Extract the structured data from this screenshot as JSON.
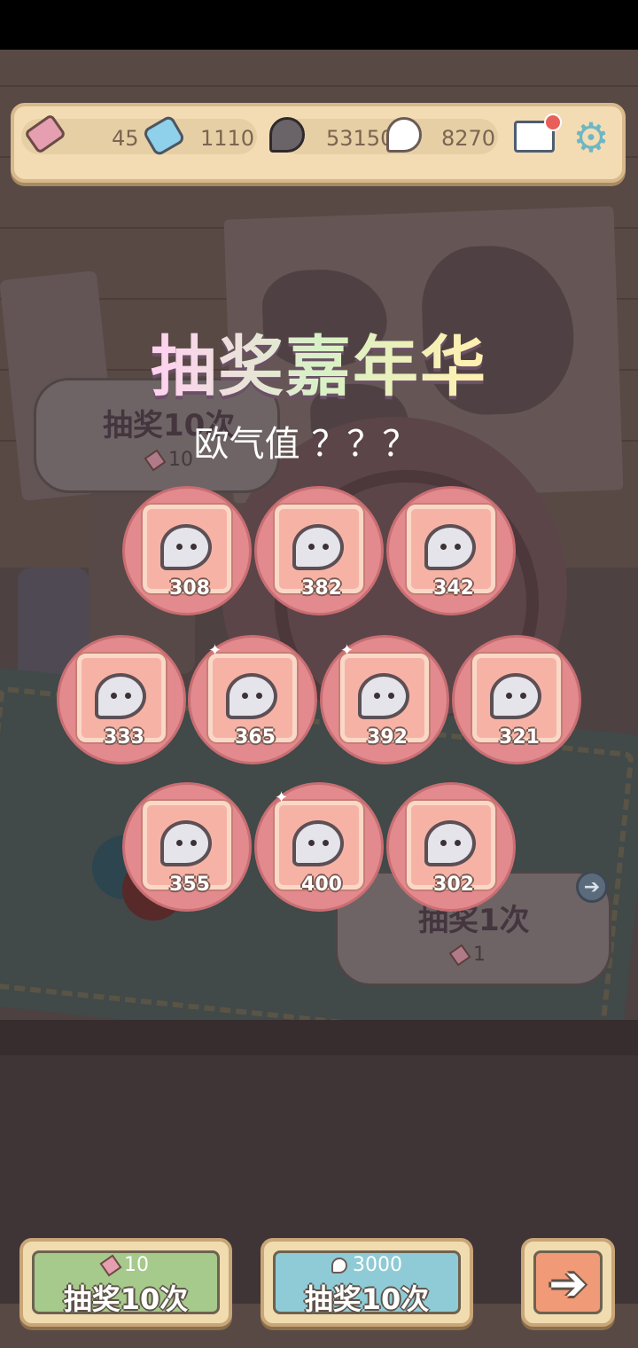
{
  "resources": {
    "tickets": "45",
    "gems": "1110",
    "dark_ghosts": "53150",
    "white_ghosts": "8270"
  },
  "header": {
    "title": "抽奖嘉年华",
    "luck_label": "欧气值 ？？？"
  },
  "background_buttons": {
    "draw10_label": "抽奖10次",
    "draw10_cost": "10",
    "draw1_label": "抽奖1次",
    "draw1_cost": "1"
  },
  "prizes": [
    {
      "value": "308"
    },
    {
      "value": "382"
    },
    {
      "value": "342"
    },
    {
      "value": "333"
    },
    {
      "value": "365"
    },
    {
      "value": "392"
    },
    {
      "value": "321"
    },
    {
      "value": "355"
    },
    {
      "value": "400"
    },
    {
      "value": "302"
    }
  ],
  "bottom": {
    "ticket_draw": {
      "cost": "10",
      "label": "抽奖10次"
    },
    "ghost_draw": {
      "cost": "3000",
      "label": "抽奖10次"
    },
    "next_icon": "right-arrow-icon"
  },
  "icons": [
    "ticket-icon",
    "gem-icon",
    "dark-ghost-icon",
    "white-ghost-icon",
    "mail-icon",
    "gear-icon"
  ],
  "colors": {
    "prize_circle": "#e28a8e",
    "prize_tile": "#f6b3a5",
    "green_button": "#a6c98c",
    "blue_button": "#8fcbd6",
    "orange_button": "#f09a78"
  }
}
